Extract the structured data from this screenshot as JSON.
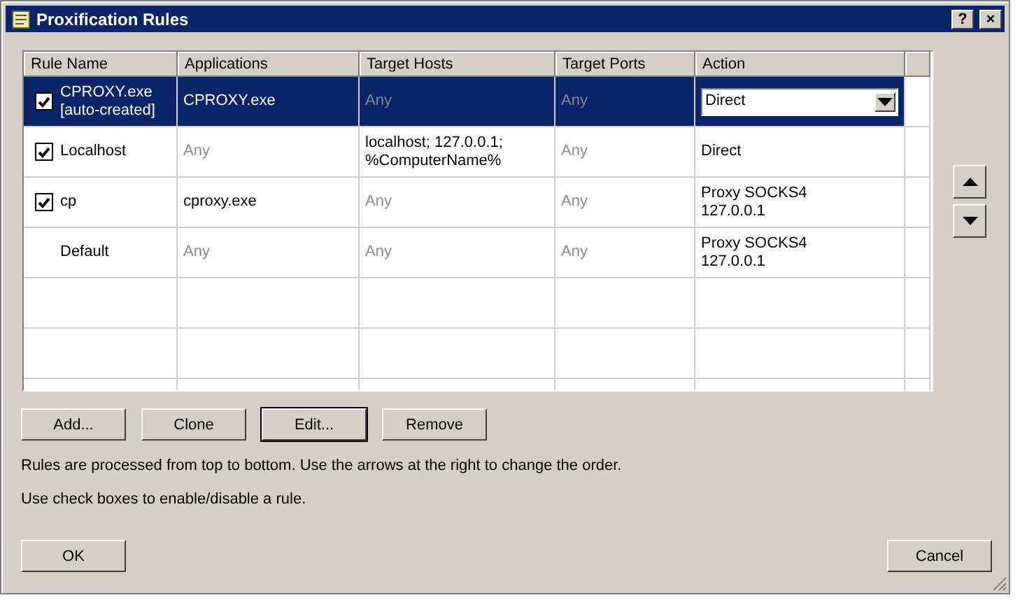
{
  "window": {
    "title": "Proxification Rules",
    "title_buttons": [
      "?",
      "×"
    ]
  },
  "table": {
    "columns": [
      "Rule Name",
      "Applications",
      "Target Hosts",
      "Target Ports",
      "Action"
    ],
    "rows": [
      {
        "selected": true,
        "kind": "rule",
        "checked": true,
        "cells": [
          {
            "text": "CPROXY.exe\n[auto-created]",
            "muted": false
          },
          {
            "text": "CPROXY.exe",
            "muted": false
          },
          {
            "text": "Any",
            "muted": true
          },
          {
            "text": "Any",
            "muted": true
          },
          {
            "text": "Direct",
            "muted": false,
            "kind": "dropdown"
          }
        ]
      },
      {
        "selected": false,
        "kind": "rule",
        "checked": true,
        "cells": [
          {
            "text": "Localhost",
            "muted": false
          },
          {
            "text": "Any",
            "muted": true
          },
          {
            "text": "localhost; 127.0.0.1;\n%ComputerName%",
            "muted": false
          },
          {
            "text": "Any",
            "muted": true
          },
          {
            "text": "Direct",
            "muted": false
          }
        ]
      },
      {
        "selected": false,
        "kind": "rule",
        "checked": true,
        "cells": [
          {
            "text": "cp",
            "muted": false
          },
          {
            "text": "cproxy.exe",
            "muted": false
          },
          {
            "text": "Any",
            "muted": true
          },
          {
            "text": "Any",
            "muted": true
          },
          {
            "text": "Proxy SOCKS4\n127.0.0.1",
            "muted": false
          }
        ]
      },
      {
        "selected": false,
        "kind": "default",
        "cells": [
          {
            "text": "Default",
            "muted": false
          },
          {
            "text": "Any",
            "muted": true
          },
          {
            "text": "Any",
            "muted": true
          },
          {
            "text": "Any",
            "muted": true
          },
          {
            "text": "Proxy SOCKS4\n127.0.0.1",
            "muted": false
          }
        ]
      }
    ]
  },
  "buttons": [
    {
      "label": "Add...",
      "focused": false
    },
    {
      "label": "Clone",
      "focused": false
    },
    {
      "label": "Edit...",
      "focused": true
    },
    {
      "label": "Remove",
      "focused": false
    }
  ],
  "hints": [
    "Rules are processed from top to bottom. Use the arrows at the right to change the order.",
    "Use check boxes to enable/disable a rule."
  ],
  "footer_buttons": [
    "OK",
    "Cancel"
  ]
}
